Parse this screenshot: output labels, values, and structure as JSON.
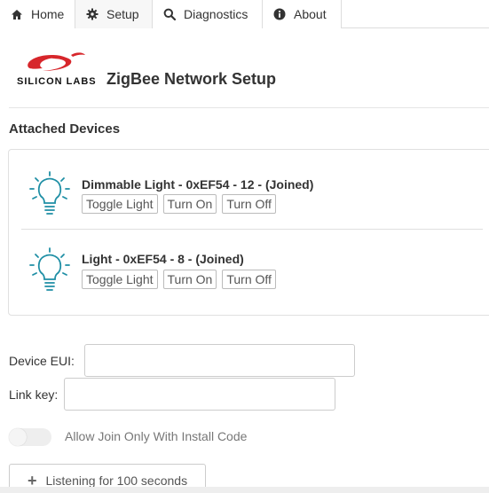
{
  "nav": {
    "tabs": [
      {
        "label": "Home",
        "icon": "home-icon"
      },
      {
        "label": "Setup",
        "icon": "gear-icon"
      },
      {
        "label": "Diagnostics",
        "icon": "search-icon"
      },
      {
        "label": "About",
        "icon": "info-icon"
      }
    ],
    "active_tab": "Setup"
  },
  "header": {
    "logo_text": "SILICON LABS",
    "title": "ZigBee Network Setup"
  },
  "attached_devices": {
    "title": "Attached Devices",
    "devices": [
      {
        "name": "Dimmable Light - 0xEF54 - 12 - (Joined)",
        "icon": "lightbulb-icon",
        "buttons": [
          "Toggle Light",
          "Turn On",
          "Turn Off"
        ]
      },
      {
        "name": "Light - 0xEF54 - 8 - (Joined)",
        "icon": "lightbulb-icon",
        "buttons": [
          "Toggle Light",
          "Turn On",
          "Turn Off"
        ]
      }
    ]
  },
  "form": {
    "device_eui_label": "Device EUI:",
    "device_eui_value": "",
    "link_key_label": "Link key:",
    "link_key_value": "",
    "install_code_toggle": {
      "label": "Allow Join Only With Install Code",
      "on": false
    },
    "listen_button": "Listening for 100 seconds"
  },
  "colors": {
    "logo_red": "#d7262b",
    "bulb_teal": "#1f8fa5",
    "tab_border": "#dddddd"
  }
}
